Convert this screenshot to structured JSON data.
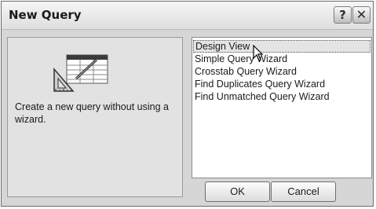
{
  "window": {
    "title": "New Query"
  },
  "title_buttons": {
    "help": "?",
    "close": "✕"
  },
  "description": "Create a new query without using a wizard.",
  "list": {
    "items": [
      "Design View",
      "Simple Query Wizard",
      "Crosstab Query Wizard",
      "Find Duplicates Query Wizard",
      "Find Unmatched Query Wizard"
    ],
    "selected_index": 0
  },
  "buttons": {
    "ok": "OK",
    "cancel": "Cancel"
  }
}
